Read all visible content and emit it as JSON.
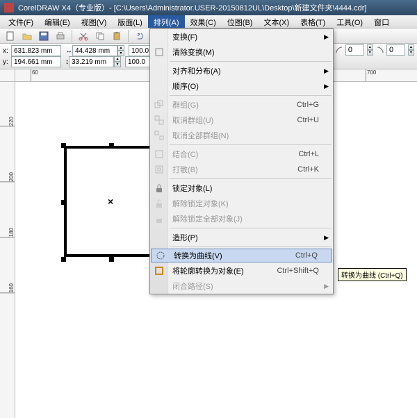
{
  "title": "CorelDRAW X4（专业版）- [C:\\Users\\Administrator.USER-20150812UL\\Desktop\\新建文件夹\\4444.cdr]",
  "menubar": {
    "file": "文件(F)",
    "edit": "编辑(E)",
    "view": "视图(V)",
    "layout": "版面(L)",
    "arrange": "排列(A)",
    "effects": "效果(C)",
    "bitmaps": "位图(B)",
    "text": "文本(X)",
    "table": "表格(T)",
    "tools": "工具(O)",
    "window": "窗口"
  },
  "props": {
    "x": "631.823 mm",
    "y": "194.661 mm",
    "w": "44.428 mm",
    "h": "33.219 mm",
    "sx": "100.0",
    "sy": "100.0",
    "a": "0",
    "b": "0"
  },
  "ruler_h": {
    "t60": "60",
    "t700": "700"
  },
  "ruler_v": {
    "t160": "160",
    "t180": "180",
    "t200": "200",
    "t220": "220"
  },
  "menu": {
    "transform": "变换(F)",
    "clear_transform": "清除变换(M)",
    "align": "对齐和分布(A)",
    "order": "顺序(O)",
    "group": "群组(G)",
    "ungroup": "取消群组(U)",
    "ungroup_all": "取消全部群组(N)",
    "combine": "结合(C)",
    "break": "打散(B)",
    "lock": "锁定对象(L)",
    "unlock": "解除锁定对象(K)",
    "unlock_all": "解除锁定全部对象(J)",
    "shaping": "造形(P)",
    "to_curve": "转换为曲线(V)",
    "outline_to_obj": "将轮廓转换为对象(E)",
    "close_path": "闭合路径(S)",
    "sc_group": "Ctrl+G",
    "sc_ungroup": "Ctrl+U",
    "sc_combine": "Ctrl+L",
    "sc_break": "Ctrl+K",
    "sc_curve": "Ctrl+Q",
    "sc_outline": "Ctrl+Shift+Q"
  },
  "tooltip": "转换为曲线 (Ctrl+Q)"
}
